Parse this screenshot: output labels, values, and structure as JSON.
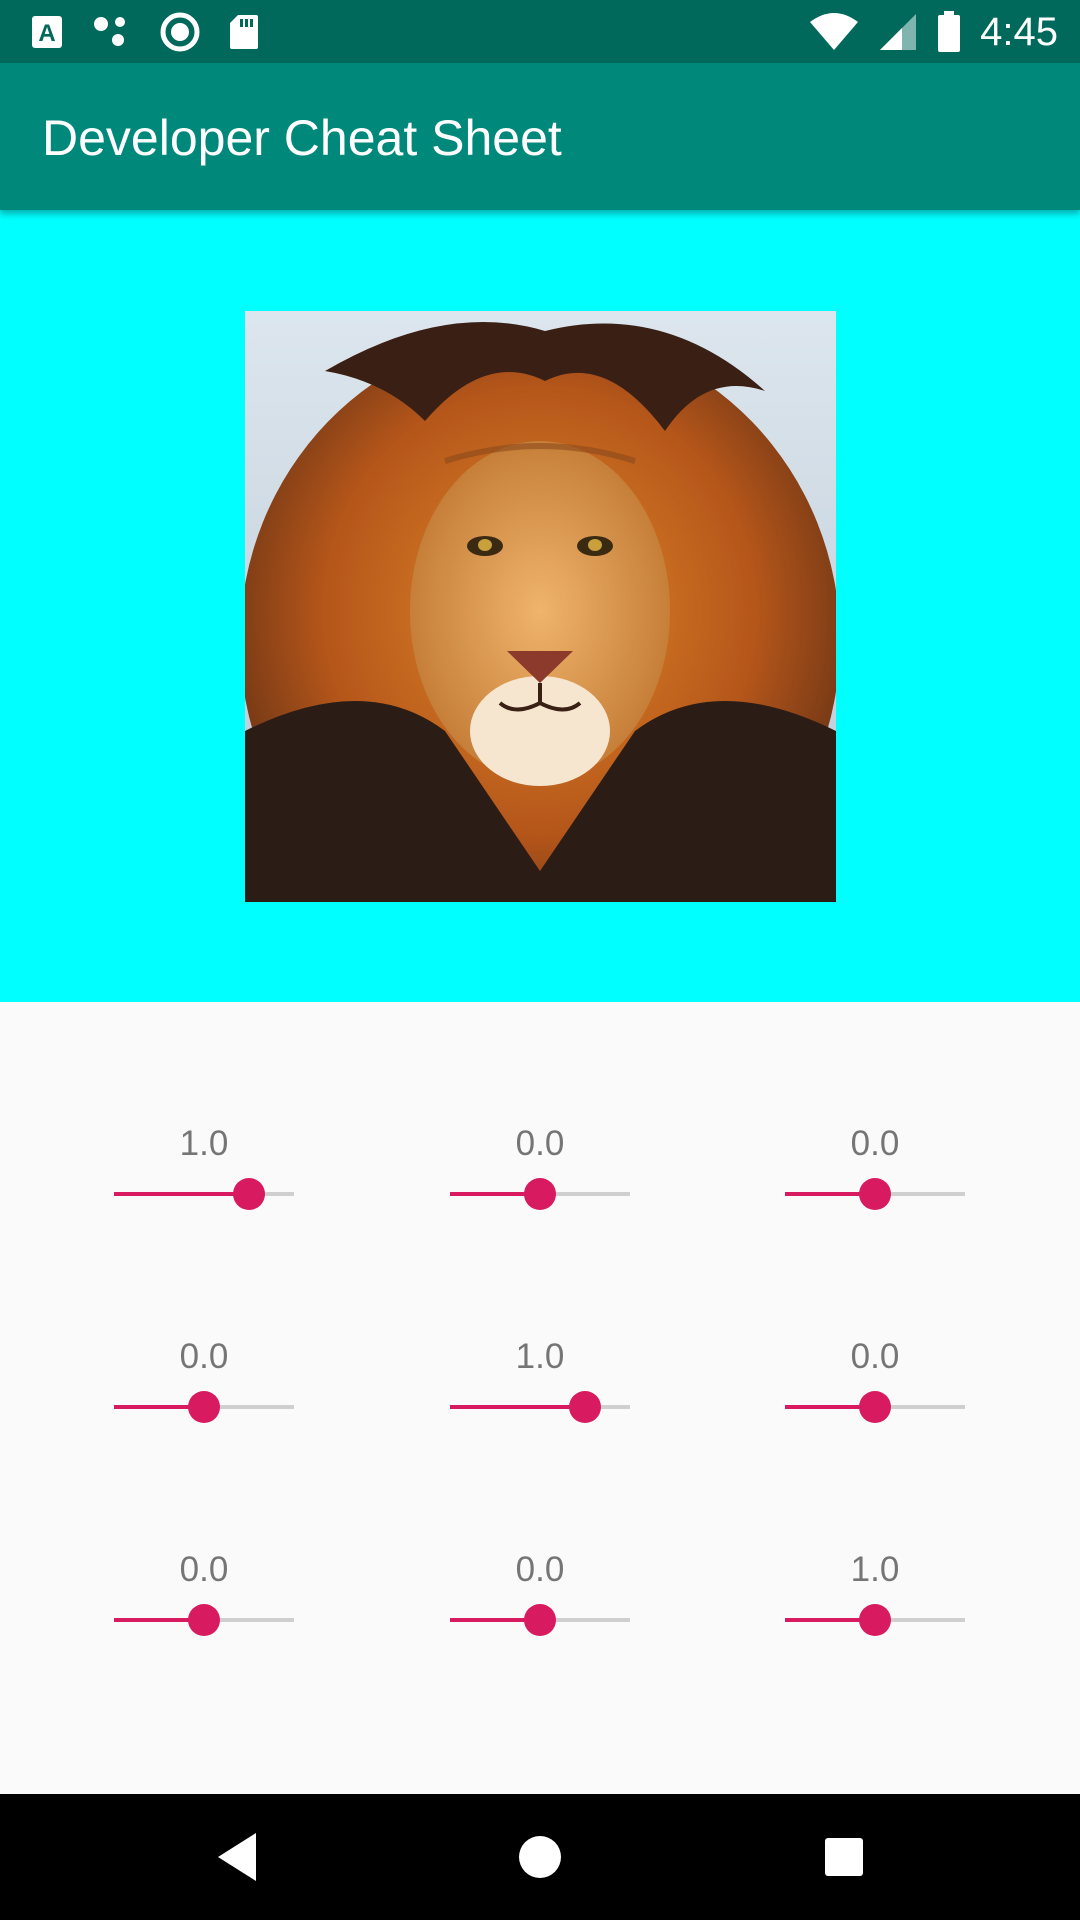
{
  "status_bar": {
    "time": "4:45",
    "icons": [
      "a-notification-icon",
      "dots-icon",
      "record-icon",
      "sd-card-icon",
      "wifi-icon",
      "cell-signal-icon",
      "battery-icon"
    ]
  },
  "app_bar": {
    "title": "Developer Cheat Sheet",
    "color": "#00897b"
  },
  "image_panel": {
    "background": "#00ffff",
    "image": "lion-photo"
  },
  "matrix": {
    "accent": "#d81b60",
    "rows": [
      [
        {
          "label": "1.0",
          "level": 0.75
        },
        {
          "label": "0.0",
          "level": 0.5
        },
        {
          "label": "0.0",
          "level": 0.5
        }
      ],
      [
        {
          "label": "0.0",
          "level": 0.5
        },
        {
          "label": "1.0",
          "level": 0.75
        },
        {
          "label": "0.0",
          "level": 0.5
        }
      ],
      [
        {
          "label": "0.0",
          "level": 0.5
        },
        {
          "label": "0.0",
          "level": 0.5
        },
        {
          "label": "1.0",
          "level": 0.5
        }
      ]
    ]
  },
  "nav_bar": {
    "buttons": [
      "back-icon",
      "home-icon",
      "recents-icon"
    ]
  }
}
